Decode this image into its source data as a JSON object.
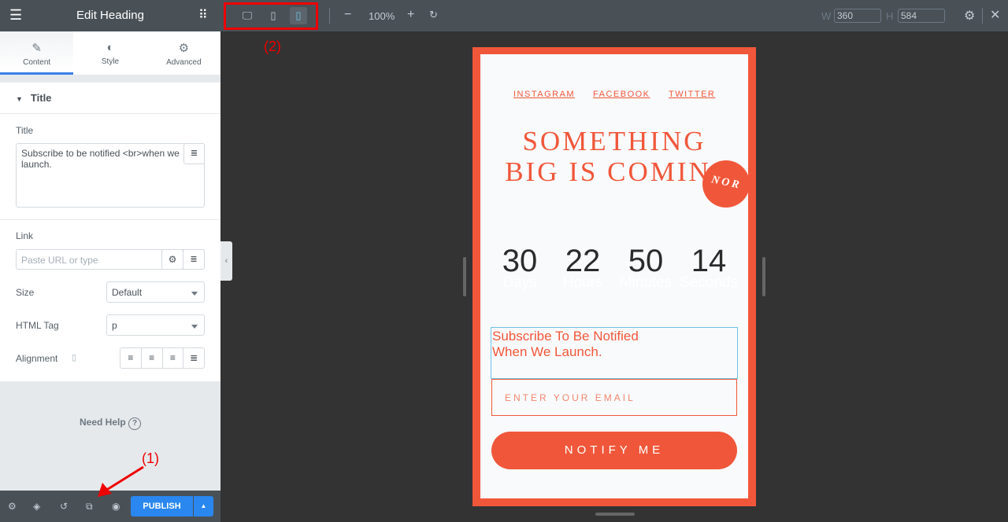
{
  "panel": {
    "title": "Edit Heading",
    "tabs": [
      {
        "label": "Content",
        "icon": "pencil-icon"
      },
      {
        "label": "Style",
        "icon": "contrast-icon"
      },
      {
        "label": "Advanced",
        "icon": "gear-icon"
      }
    ],
    "section": "Title",
    "title_label": "Title",
    "title_value": "Subscribe to be notified <br>when we launch.",
    "link_label": "Link",
    "link_placeholder": "Paste URL or type",
    "size_label": "Size",
    "size_value": "Default",
    "tag_label": "HTML Tag",
    "tag_value": "p",
    "align_label": "Alignment",
    "help": "Need Help",
    "help_icon": "?",
    "publish": "PUBLISH"
  },
  "topbar": {
    "zoom": "100%",
    "w_label": "W",
    "w_value": "360",
    "h_label": "H",
    "h_value": "584",
    "active_device": "mobile"
  },
  "preview": {
    "social": [
      "INSTAGRAM",
      "FACEBOOK",
      "TWITTER"
    ],
    "headline1": "SOMETHING",
    "headline2": "BIG IS COMIN",
    "badge": "NOR",
    "countdown": [
      {
        "n": "30",
        "u": "Days"
      },
      {
        "n": "22",
        "u": "Hours"
      },
      {
        "n": "50",
        "u": "Minutes"
      },
      {
        "n": "14",
        "u": "Seconds"
      }
    ],
    "sub1": "Subscribe To Be Notified",
    "sub2": "When We Launch.",
    "email_placeholder": "ENTER YOUR EMAIL",
    "notify": "NOTIFY ME"
  },
  "annotations": {
    "one": "(1)",
    "two": "(2)"
  },
  "colors": {
    "accent": "#f0573a",
    "publish": "#2a87f0",
    "panel_dark": "#495157"
  }
}
